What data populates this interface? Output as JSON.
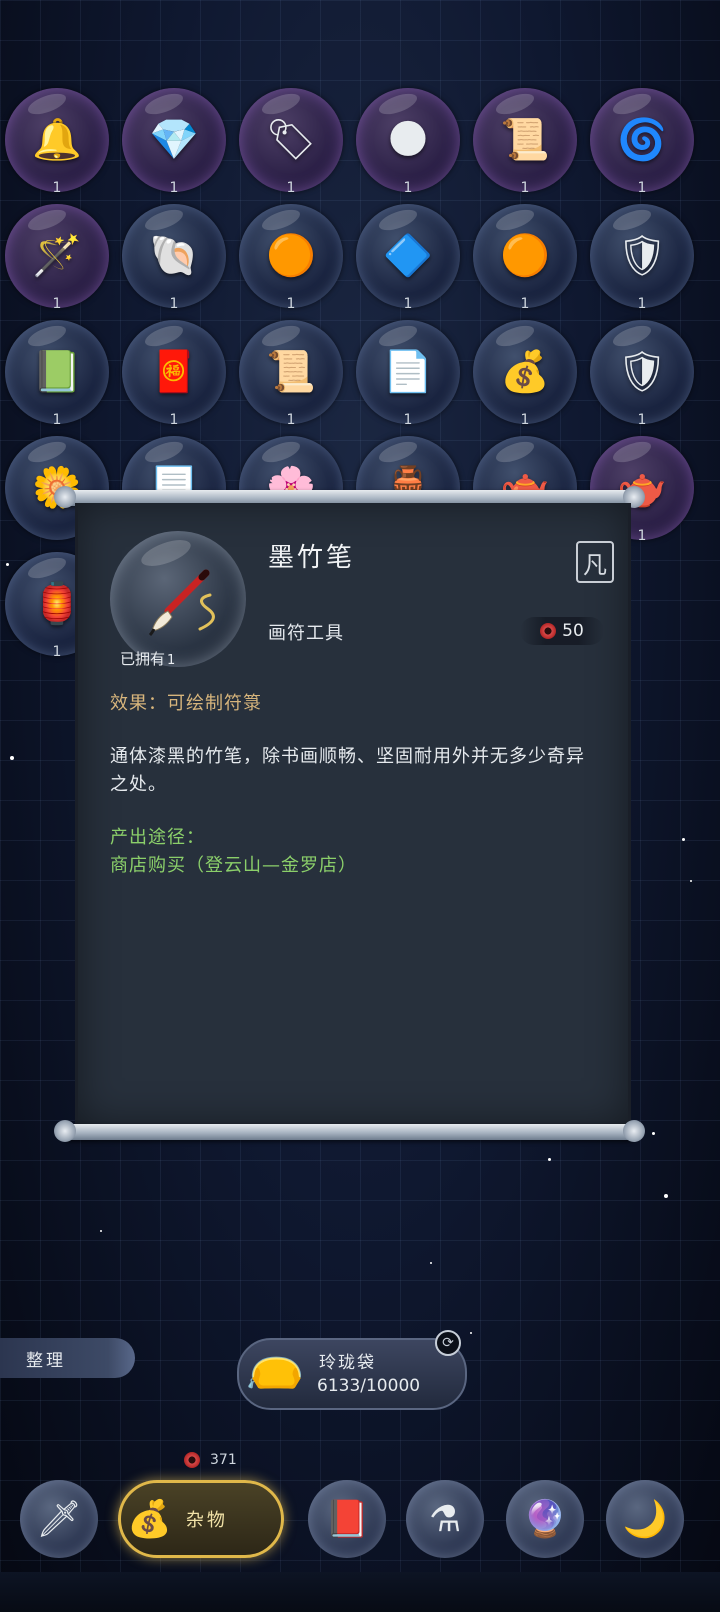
{
  "inventory": {
    "rows": [
      [
        {
          "icon": "golden-bells-icon",
          "glyph": "🔔",
          "count": "1",
          "rare": true
        },
        {
          "icon": "blue-crystal-icon",
          "glyph": "💎",
          "count": "1",
          "rare": true
        },
        {
          "icon": "jade-talisman-icon",
          "glyph": "🏷",
          "count": "1",
          "rare": true
        },
        {
          "icon": "dark-sphere-icon",
          "glyph": "🌑",
          "count": "1",
          "rare": true
        },
        {
          "icon": "scroll-map-icon",
          "glyph": "📜",
          "count": "1",
          "rare": true
        },
        {
          "icon": "green-spirit-icon",
          "glyph": "🌀",
          "count": "1",
          "rare": true
        }
      ],
      [
        {
          "icon": "scroll-staff-icon",
          "glyph": "🪄",
          "count": "1",
          "rare": true
        },
        {
          "icon": "conch-shell-icon",
          "glyph": "🐚",
          "count": "1",
          "rare": false
        },
        {
          "icon": "orange-pendant-icon",
          "glyph": "🟠",
          "count": "1",
          "rare": false
        },
        {
          "icon": "blue-charm-icon",
          "glyph": "🔷",
          "count": "1",
          "rare": false
        },
        {
          "icon": "orange-pendant-icon",
          "glyph": "🟠",
          "count": "1",
          "rare": false
        },
        {
          "icon": "red-emblem-icon",
          "glyph": "🛡",
          "count": "1",
          "rare": false
        }
      ],
      [
        {
          "icon": "green-book-icon",
          "glyph": "📗",
          "count": "1",
          "rare": false
        },
        {
          "icon": "red-seal-icon",
          "glyph": "🧧",
          "count": "1",
          "rare": false
        },
        {
          "icon": "old-scroll-icon",
          "glyph": "📜",
          "count": "1",
          "rare": false
        },
        {
          "icon": "paper-note-icon",
          "glyph": "📄",
          "count": "1",
          "rare": false
        },
        {
          "icon": "money-bag-icon",
          "glyph": "💰",
          "count": "1",
          "rare": false
        },
        {
          "icon": "red-emblem-icon",
          "glyph": "🛡",
          "count": "1",
          "rare": false
        }
      ],
      [
        {
          "icon": "flower-staff-icon",
          "glyph": "🌼",
          "count": "",
          "rare": false
        },
        {
          "icon": "paper-stack-icon",
          "glyph": "📃",
          "count": "",
          "rare": false
        },
        {
          "icon": "dark-flower-icon",
          "glyph": "🌸",
          "count": "",
          "rare": false
        },
        {
          "icon": "vase-icon",
          "glyph": "🏺",
          "count": "",
          "rare": false
        },
        {
          "icon": "teapot-icon",
          "glyph": "🫖",
          "count": "",
          "rare": false
        },
        {
          "icon": "purple-teapot-icon",
          "glyph": "🫖",
          "count": "1",
          "rare": true
        }
      ],
      [
        {
          "icon": "bronze-cauldron-icon",
          "glyph": "🏮",
          "count": "1",
          "rare": false
        }
      ]
    ]
  },
  "popup": {
    "owned_label": "已拥有",
    "owned_count": "1",
    "item_name": "墨竹笔",
    "seal_char": "凡",
    "subtype": "画符工具",
    "price": "50",
    "effect": "效果：可绘制符箓",
    "description": "通体漆黑的竹笔，除书画顺畅、坚固耐用外并无多少奇异之处。",
    "source_label": "产出途径：",
    "source_value": "商店购买（登云山—金罗店）"
  },
  "bottom": {
    "sort_label": "整理",
    "bag_name": "玲珑袋",
    "bag_capacity": "6133/10000",
    "coin_count": "371",
    "tabs": [
      {
        "name": "weapon",
        "glyph": "🗡"
      },
      {
        "name": "misc",
        "glyph": "💰",
        "label": "杂物"
      },
      {
        "name": "book",
        "glyph": "📕"
      },
      {
        "name": "potion",
        "glyph": "⚗"
      },
      {
        "name": "crystal",
        "glyph": "🔮"
      },
      {
        "name": "special",
        "glyph": "🌙"
      }
    ]
  },
  "colors": {
    "effect": "#d7b57c",
    "source": "#8bcf6a",
    "active_tab_border": "#e0b84a"
  }
}
